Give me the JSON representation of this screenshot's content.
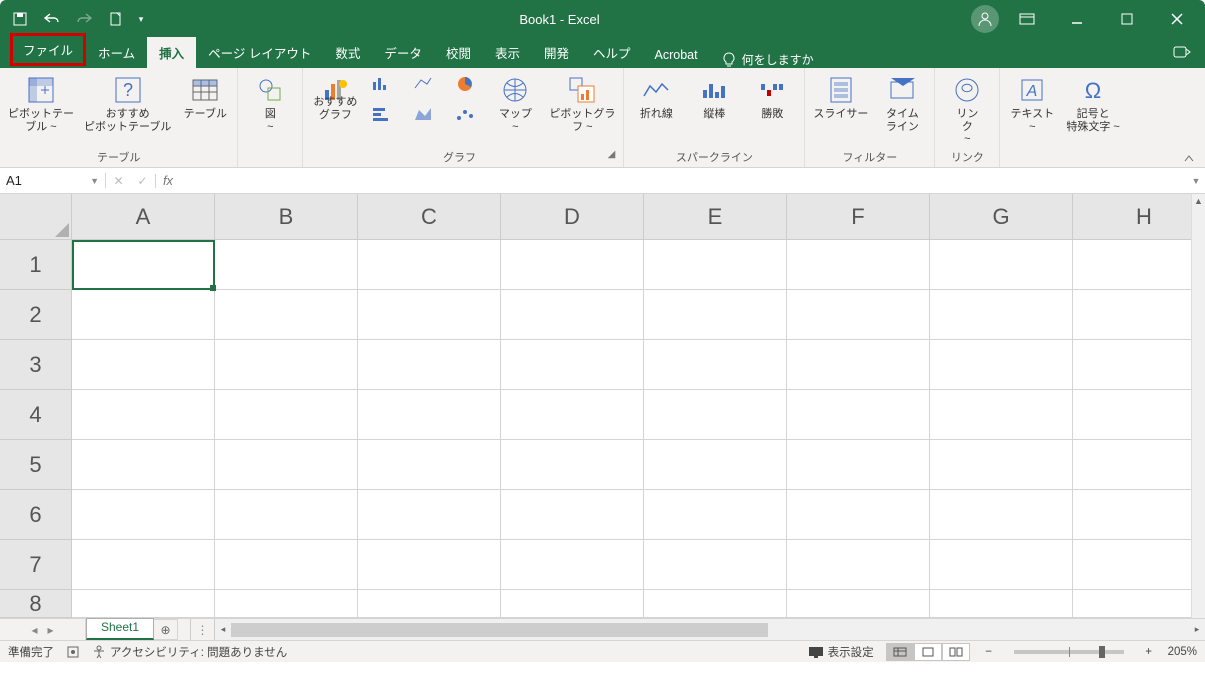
{
  "title": "Book1  -  Excel",
  "qat": {
    "save": "save",
    "undo": "undo",
    "redo": "redo",
    "newfile": "newfile"
  },
  "tabs": {
    "file": "ファイル",
    "home": "ホーム",
    "insert": "挿入",
    "pageLayout": "ページ レイアウト",
    "formulas": "数式",
    "data": "データ",
    "review": "校閲",
    "view": "表示",
    "developer": "開発",
    "help": "ヘルプ",
    "acrobat": "Acrobat",
    "tellMe": "何をしますか"
  },
  "ribbon": {
    "tables": {
      "pivot": "ピボットテー\nブル ~",
      "recPivot": "おすすめ\nピボットテーブル",
      "table": "テーブル",
      "group": "テーブル"
    },
    "illus": {
      "shapes": "図\n~"
    },
    "charts": {
      "rec": "おすすめ\nグラフ",
      "maps": "マップ\n~",
      "pivotChart": "ピボットグラ\nフ ~",
      "group": "グラフ"
    },
    "sparklines": {
      "line": "折れ線",
      "column": "縦棒",
      "winloss": "勝敗",
      "group": "スパークライン"
    },
    "filters": {
      "slicer": "スライサー",
      "timeline": "タイム\nライン",
      "group": "フィルター"
    },
    "links": {
      "link": "リン\nク\n~",
      "group": "リンク"
    },
    "text": {
      "text": "テキスト\n~"
    },
    "symbols": {
      "symbol": "記号と\n特殊文字 ~"
    }
  },
  "namebox": "A1",
  "formula": "",
  "columns": [
    "A",
    "B",
    "C",
    "D",
    "E",
    "F",
    "G",
    "H"
  ],
  "rows": [
    "1",
    "2",
    "3",
    "4",
    "5",
    "6",
    "7",
    "8"
  ],
  "sheet": {
    "name": "Sheet1"
  },
  "status": {
    "ready": "準備完了",
    "accessibility": "アクセシビリティ: 問題ありません",
    "display": "表示設定",
    "zoom": "205%"
  }
}
